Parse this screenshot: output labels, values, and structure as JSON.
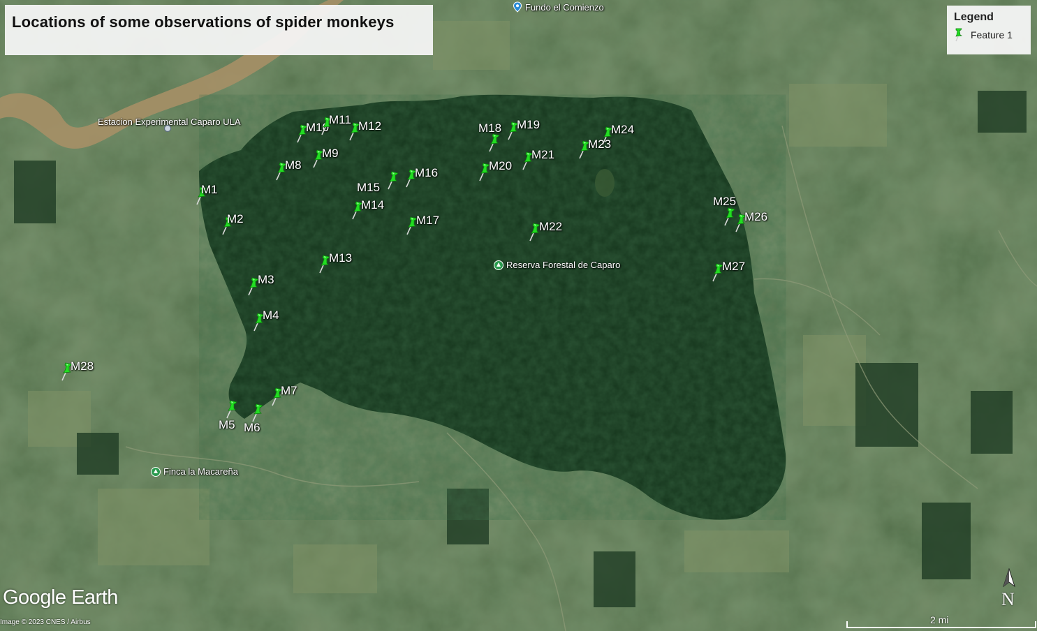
{
  "title": "Locations of some observations of spider monkeys",
  "legend": {
    "title": "Legend",
    "items": [
      {
        "label": "Feature 1",
        "color": "#22dd22"
      }
    ]
  },
  "markers": [
    {
      "label": "M1"
    },
    {
      "label": "M2"
    },
    {
      "label": "M3"
    },
    {
      "label": "M4"
    },
    {
      "label": "M5"
    },
    {
      "label": "M6"
    },
    {
      "label": "M7"
    },
    {
      "label": "M8"
    },
    {
      "label": "M9"
    },
    {
      "label": "M10"
    },
    {
      "label": "M11"
    },
    {
      "label": "M12"
    },
    {
      "label": "M13"
    },
    {
      "label": "M14"
    },
    {
      "label": "M15"
    },
    {
      "label": "M16"
    },
    {
      "label": "M17"
    },
    {
      "label": "M18"
    },
    {
      "label": "M19"
    },
    {
      "label": "M20"
    },
    {
      "label": "M21"
    },
    {
      "label": "M22"
    },
    {
      "label": "M23"
    },
    {
      "label": "M24"
    },
    {
      "label": "M25"
    },
    {
      "label": "M26"
    },
    {
      "label": "M27"
    },
    {
      "label": "M28"
    }
  ],
  "places": [
    {
      "label": "Fundo el Comienzo",
      "icon": "location-pin-icon"
    },
    {
      "label": "Estacion Experimental Caparo ULA",
      "icon": "location-dot-icon"
    },
    {
      "label": "Reserva Forestal de Caparo",
      "icon": "park-icon"
    },
    {
      "label": "Finca la Macareña",
      "icon": "park-icon"
    }
  ],
  "branding": "Google Earth",
  "attribution": "Image © 2023 CNES / Airbus",
  "scale": {
    "label": "2 mi"
  },
  "compass": {
    "letter": "N"
  },
  "colors": {
    "pin": "#22dd22",
    "forest": "#16361d",
    "river": "#9c8a66"
  }
}
